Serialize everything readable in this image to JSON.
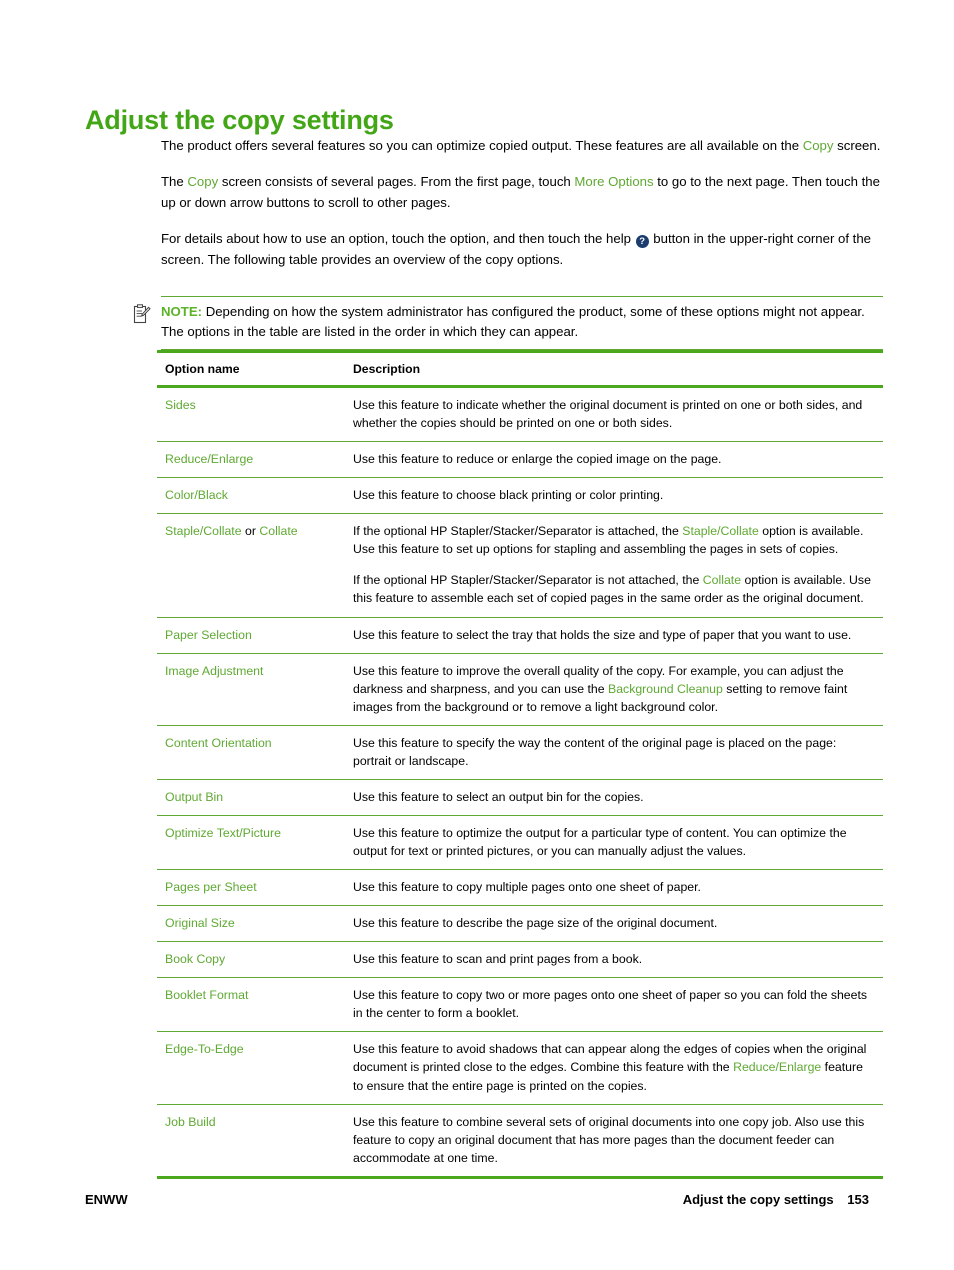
{
  "document": {
    "title": "Adjust the copy settings",
    "intro_paragraphs": [
      {
        "id": "p1",
        "runs": [
          {
            "t": "The product offers several features so you can optimize copied output. These features are all available on the ",
            "s": "plain"
          },
          {
            "t": "Copy",
            "s": "ui"
          },
          {
            "t": " screen.",
            "s": "plain"
          }
        ]
      },
      {
        "id": "p2",
        "runs": [
          {
            "t": "The ",
            "s": "plain"
          },
          {
            "t": "Copy",
            "s": "ui"
          },
          {
            "t": " screen consists of several pages. From the first page, touch ",
            "s": "plain"
          },
          {
            "t": "More Options",
            "s": "ui"
          },
          {
            "t": " to go to the next page. Then touch the up or down arrow buttons to scroll to other pages.",
            "s": "plain"
          }
        ]
      },
      {
        "id": "p3",
        "runs": [
          {
            "t": "For details about how to use an option, touch the option, and then touch the help ",
            "s": "plain"
          },
          {
            "t": "?",
            "s": "help-icon"
          },
          {
            "t": " button in the upper-right corner of the screen. The following table provides an overview of the copy options.",
            "s": "plain"
          }
        ]
      }
    ],
    "note": {
      "icon": "note-clipboard-icon",
      "label": "NOTE:",
      "text": "Depending on how the system administrator has configured the product, some of these options might not appear. The options in the table are listed in the order in which they can appear."
    },
    "table": {
      "headers": [
        "Option name",
        "Description"
      ],
      "rows": [
        {
          "option_runs": [
            {
              "t": "Sides",
              "s": "ui"
            }
          ],
          "option_plain": "Sides",
          "description_paragraphs": [
            [
              {
                "t": "Use this feature to indicate whether the original document is printed on one or both sides, and whether the copies should be printed on one or both sides.",
                "s": "plain"
              }
            ]
          ]
        },
        {
          "option_runs": [
            {
              "t": "Reduce/Enlarge",
              "s": "ui"
            }
          ],
          "option_plain": "Reduce/Enlarge",
          "description_paragraphs": [
            [
              {
                "t": "Use this feature to reduce or enlarge the copied image on the page.",
                "s": "plain"
              }
            ]
          ]
        },
        {
          "option_runs": [
            {
              "t": "Color/Black",
              "s": "ui"
            }
          ],
          "option_plain": "Color/Black",
          "description_paragraphs": [
            [
              {
                "t": "Use this feature to choose black printing or color printing.",
                "s": "plain"
              }
            ]
          ]
        },
        {
          "option_runs": [
            {
              "t": "Staple/Collate",
              "s": "ui"
            },
            {
              "t": " or ",
              "s": "plain"
            },
            {
              "t": "Collate",
              "s": "ui"
            }
          ],
          "option_plain": "Staple/Collate or Collate",
          "description_paragraphs": [
            [
              {
                "t": "If the optional HP Stapler/Stacker/Separator is attached, the ",
                "s": "plain"
              },
              {
                "t": "Staple/Collate",
                "s": "ui"
              },
              {
                "t": " option is available. Use this feature to set up options for stapling and assembling the pages in sets of copies.",
                "s": "plain"
              }
            ],
            [
              {
                "t": "If the optional HP Stapler/Stacker/Separator is not attached, the ",
                "s": "plain"
              },
              {
                "t": "Collate",
                "s": "ui"
              },
              {
                "t": " option is available. Use this feature to assemble each set of copied pages in the same order as the original document.",
                "s": "plain"
              }
            ]
          ]
        },
        {
          "option_runs": [
            {
              "t": "Paper Selection",
              "s": "ui"
            }
          ],
          "option_plain": "Paper Selection",
          "description_paragraphs": [
            [
              {
                "t": "Use this feature to select the tray that holds the size and type of paper that you want to use.",
                "s": "plain"
              }
            ]
          ]
        },
        {
          "option_runs": [
            {
              "t": "Image Adjustment",
              "s": "ui"
            }
          ],
          "option_plain": "Image Adjustment",
          "description_paragraphs": [
            [
              {
                "t": "Use this feature to improve the overall quality of the copy. For example, you can adjust the darkness and sharpness, and you can use the ",
                "s": "plain"
              },
              {
                "t": "Background Cleanup",
                "s": "ui"
              },
              {
                "t": " setting to remove faint images from the background or to remove a light background color.",
                "s": "plain"
              }
            ]
          ]
        },
        {
          "option_runs": [
            {
              "t": "Content Orientation",
              "s": "ui"
            }
          ],
          "option_plain": "Content Orientation",
          "description_paragraphs": [
            [
              {
                "t": "Use this feature to specify the way the content of the original page is placed on the page: portrait or landscape.",
                "s": "plain"
              }
            ]
          ]
        },
        {
          "option_runs": [
            {
              "t": "Output Bin",
              "s": "ui"
            }
          ],
          "option_plain": "Output Bin",
          "description_paragraphs": [
            [
              {
                "t": "Use this feature to select an output bin for the copies.",
                "s": "plain"
              }
            ]
          ]
        },
        {
          "option_runs": [
            {
              "t": "Optimize Text/Picture",
              "s": "ui"
            }
          ],
          "option_plain": "Optimize Text/Picture",
          "description_paragraphs": [
            [
              {
                "t": "Use this feature to optimize the output for a particular type of content. You can optimize the output for text or printed pictures, or you can manually adjust the values.",
                "s": "plain"
              }
            ]
          ]
        },
        {
          "option_runs": [
            {
              "t": "Pages per Sheet",
              "s": "ui"
            }
          ],
          "option_plain": "Pages per Sheet",
          "description_paragraphs": [
            [
              {
                "t": "Use this feature to copy multiple pages onto one sheet of paper.",
                "s": "plain"
              }
            ]
          ]
        },
        {
          "option_runs": [
            {
              "t": "Original Size",
              "s": "ui"
            }
          ],
          "option_plain": "Original Size",
          "description_paragraphs": [
            [
              {
                "t": "Use this feature to describe the page size of the original document.",
                "s": "plain"
              }
            ]
          ]
        },
        {
          "option_runs": [
            {
              "t": "Book Copy",
              "s": "ui"
            }
          ],
          "option_plain": "Book Copy",
          "description_paragraphs": [
            [
              {
                "t": "Use this feature to scan and print pages from a book.",
                "s": "plain"
              }
            ]
          ]
        },
        {
          "option_runs": [
            {
              "t": "Booklet Format",
              "s": "ui"
            }
          ],
          "option_plain": "Booklet Format",
          "description_paragraphs": [
            [
              {
                "t": "Use this feature to copy two or more pages onto one sheet of paper so you can fold the sheets in the center to form a booklet.",
                "s": "plain"
              }
            ]
          ]
        },
        {
          "option_runs": [
            {
              "t": "Edge-To-Edge",
              "s": "ui"
            }
          ],
          "option_plain": "Edge-To-Edge",
          "description_paragraphs": [
            [
              {
                "t": "Use this feature to avoid shadows that can appear along the edges of copies when the original document is printed close to the edges. Combine this feature with the ",
                "s": "plain"
              },
              {
                "t": "Reduce/Enlarge",
                "s": "ui"
              },
              {
                "t": " feature to ensure that the entire page is printed on the copies.",
                "s": "plain"
              }
            ]
          ]
        },
        {
          "option_runs": [
            {
              "t": "Job Build",
              "s": "ui"
            }
          ],
          "option_plain": "Job Build",
          "description_paragraphs": [
            [
              {
                "t": "Use this feature to combine several sets of original documents into one copy job. Also use this feature to copy an original document that has more pages than the document feeder can accommodate at one time.",
                "s": "plain"
              }
            ]
          ]
        }
      ]
    },
    "footer": {
      "left": "ENWW",
      "right_label": "Adjust the copy settings",
      "page_number": "153"
    },
    "colors": {
      "title_green": "#42a616",
      "link_green": "#5fa933",
      "rule_green": "#4ba81c",
      "help_icon_blue": "#1b3d6e",
      "text_black": "#000000"
    }
  }
}
